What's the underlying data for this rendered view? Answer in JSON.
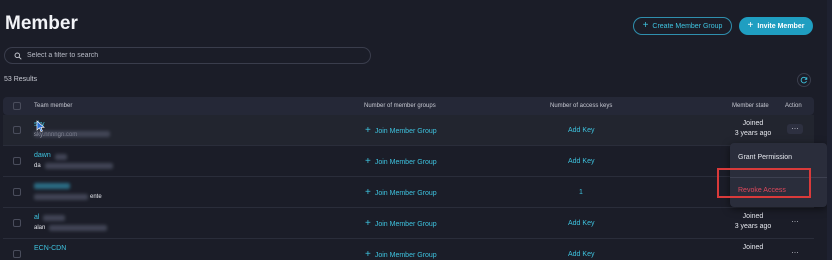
{
  "title": "Member",
  "actions": {
    "create_group_label": "Create Member Group",
    "invite_label": "Invite Member"
  },
  "search": {
    "placeholder": "Select a filter to search"
  },
  "results_label": "53 Results",
  "table": {
    "headers": {
      "member": "Team member",
      "groups": "Number of member groups",
      "keys": "Number of access keys",
      "state": "Member state",
      "action": "Action"
    },
    "rows": [
      {
        "name": "sky",
        "email": "sky.nnnngn.com",
        "groups": "Join Member Group",
        "keys": "Add Key",
        "state": "Joined",
        "since": "3 years ago"
      },
      {
        "name": "dawn",
        "email": "da",
        "groups": "Join Member Group",
        "keys": "Add Key",
        "state": "",
        "since": ""
      },
      {
        "name": "",
        "email": "ente",
        "groups": "Join Member Group",
        "keys": "1",
        "state": "",
        "since": ""
      },
      {
        "name": "al",
        "email": "alan",
        "groups": "Join Member Group",
        "keys": "Add Key",
        "state": "Joined",
        "since": "3 years ago"
      },
      {
        "name": "ECN-CDN",
        "email": "",
        "groups": "Join Member Group",
        "keys": "Add Key",
        "state": "Joined",
        "since": ""
      }
    ]
  },
  "action_menu": {
    "grant": "Grant Permission",
    "revoke": "Revoke Access"
  },
  "colors": {
    "background": "#1b1d28",
    "accent": "#3ec3df",
    "primary_button": "#1f9ec1",
    "danger": "#e0485c",
    "annotation": "#d93a3a"
  },
  "icons": [
    "plus-icon",
    "search-icon",
    "refresh-icon",
    "checkbox-icon",
    "more-icon",
    "cursor-icon"
  ]
}
